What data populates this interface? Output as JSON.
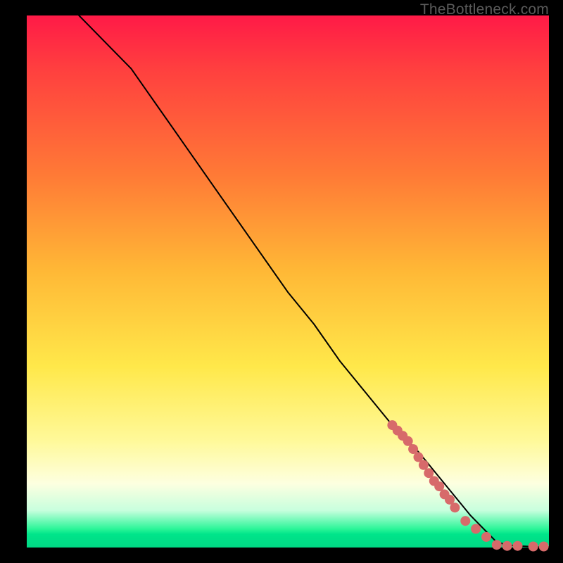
{
  "watermark": "TheBottleneck.com",
  "chart_data": {
    "type": "line",
    "title": "",
    "xlabel": "",
    "ylabel": "",
    "xlim": [
      0,
      100
    ],
    "ylim": [
      0,
      100
    ],
    "grid": false,
    "legend": false,
    "series": [
      {
        "name": "curve",
        "x": [
          10,
          12,
          15,
          20,
          25,
          30,
          35,
          40,
          45,
          50,
          55,
          60,
          65,
          70,
          75,
          80,
          85,
          88,
          90,
          92,
          94,
          96,
          98,
          100
        ],
        "y": [
          100,
          98,
          95,
          90,
          83,
          76,
          69,
          62,
          55,
          48,
          42,
          35,
          29,
          23,
          18,
          12,
          6,
          3,
          1,
          0.5,
          0.3,
          0.2,
          0.1,
          0.1
        ]
      }
    ],
    "points": {
      "name": "markers",
      "color": "#d76a6a",
      "x": [
        70,
        71,
        72,
        73,
        74,
        75,
        76,
        77,
        78,
        79,
        80,
        81,
        82,
        84,
        86,
        88,
        90,
        92,
        94,
        97,
        99
      ],
      "y": [
        23,
        22,
        21,
        20,
        18.5,
        17,
        15.5,
        14,
        12.5,
        11.5,
        10,
        9,
        7.5,
        5,
        3.5,
        2,
        0.5,
        0.3,
        0.3,
        0.2,
        0.2
      ]
    }
  }
}
